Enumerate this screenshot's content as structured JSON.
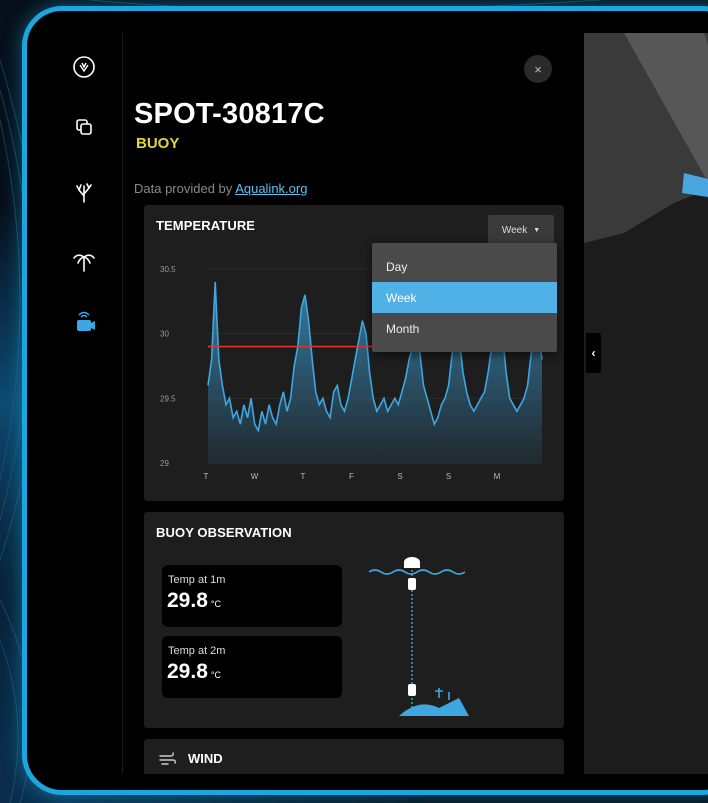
{
  "station": {
    "name": "SPOT-30817C",
    "type": "BUOY",
    "provider_prefix": "Data provided by ",
    "provider_link": "Aqualink.org",
    "close_label": "×"
  },
  "temperature": {
    "title": "TEMPERATURE",
    "range_selected": "Week",
    "range_options": [
      "Day",
      "Week",
      "Month"
    ],
    "range_active_index": 1
  },
  "chart_data": {
    "type": "area",
    "title": "TEMPERATURE",
    "categories": [
      "T",
      "W",
      "T",
      "F",
      "S",
      "S",
      "M"
    ],
    "y_ticks": [
      "30.5",
      "30",
      "29.5",
      "29"
    ],
    "ylim": [
      29,
      30.5
    ],
    "reference_line": 29.9,
    "reference_color": "#e0322b",
    "series_color": "#3ea6e0",
    "values": [
      29.6,
      29.8,
      30.4,
      29.8,
      29.6,
      29.45,
      29.5,
      29.35,
      29.4,
      29.3,
      29.45,
      29.35,
      29.5,
      29.3,
      29.25,
      29.4,
      29.3,
      29.45,
      29.35,
      29.3,
      29.45,
      29.55,
      29.4,
      29.5,
      29.75,
      29.9,
      30.2,
      30.3,
      30.1,
      29.8,
      29.55,
      29.45,
      29.5,
      29.4,
      29.35,
      29.55,
      29.6,
      29.45,
      29.4,
      29.5,
      29.65,
      29.8,
      29.95,
      30.1,
      30.0,
      29.7,
      29.5,
      29.4,
      29.45,
      29.5,
      29.4,
      29.45,
      29.5,
      29.45,
      29.55,
      29.65,
      29.8,
      29.9,
      29.95,
      29.85,
      29.6,
      29.5,
      29.4,
      29.3,
      29.35,
      29.45,
      29.5,
      29.6,
      29.85,
      30.0,
      29.95,
      29.7,
      29.55,
      29.45,
      29.4,
      29.45,
      29.5,
      29.55,
      29.7,
      29.9,
      30.05,
      30.15,
      30.0,
      29.7,
      29.5,
      29.45,
      29.4,
      29.45,
      29.5,
      29.6,
      29.85,
      30.05,
      30.0,
      29.8
    ]
  },
  "observation": {
    "title": "BUOY OBSERVATION",
    "readings": [
      {
        "label": "Temp at 1m",
        "value": "29.8",
        "unit": "°C"
      },
      {
        "label": "Temp at 2m",
        "value": "29.8",
        "unit": "°C"
      }
    ]
  },
  "wind": {
    "title": "WIND"
  },
  "colors": {
    "accent": "#1ca6df",
    "type_label": "#e3d43b",
    "link": "#5cc4f2"
  },
  "icons": {
    "rail": [
      "app-logo-icon",
      "layers-icon",
      "coral-icon",
      "palm-tree-icon",
      "buoy-icon"
    ]
  }
}
